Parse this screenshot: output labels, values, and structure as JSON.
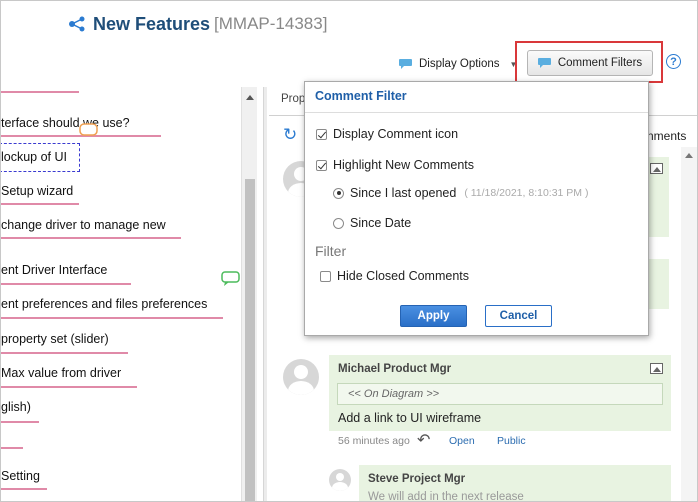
{
  "header": {
    "title": "New Features",
    "key": "[MMAP-14383]"
  },
  "toolbar": {
    "display_options_label": "Display Options",
    "comment_filters_label": "Comment Filters",
    "help_label": "?"
  },
  "mindmap": {
    "nodes": [
      "terface should we use?",
      "lockup of UI",
      "Setup wizard",
      "change driver to manage new",
      "ent Driver Interface",
      "ent preferences and files preferences",
      " property set (slider)",
      "Max value from driver",
      "glish)",
      "Setting"
    ]
  },
  "right_pane": {
    "properties_tab": "Prop",
    "comments_partial": "nments",
    "comments": [
      {
        "author": "Michael Product Mgr",
        "diagram_ref": "<< On Diagram >>",
        "text": "Add a link to UI wireframe",
        "time": "56 minutes ago",
        "open_label": "Open",
        "public_label": "Public"
      },
      {
        "author": "Steve Project Mgr",
        "text": "We will add in the next release"
      }
    ]
  },
  "popup": {
    "title": "Comment Filter",
    "display_comment_icon": "Display Comment icon",
    "highlight_new_comments": "Highlight New Comments",
    "since_last_opened": "Since I last opened",
    "last_opened_date": "( 11/18/2021, 8:10:31 PM )",
    "since_date": "Since Date",
    "filter_section": "Filter",
    "hide_closed_comments": "Hide Closed Comments",
    "apply_label": "Apply",
    "cancel_label": "Cancel"
  },
  "colors": {
    "accent_blue": "#2a6fc7",
    "title_blue": "#1f4e79",
    "highlight_red": "#d9383a",
    "comment_bg": "#e8f3e1",
    "node_underline": "#e08aa8"
  }
}
